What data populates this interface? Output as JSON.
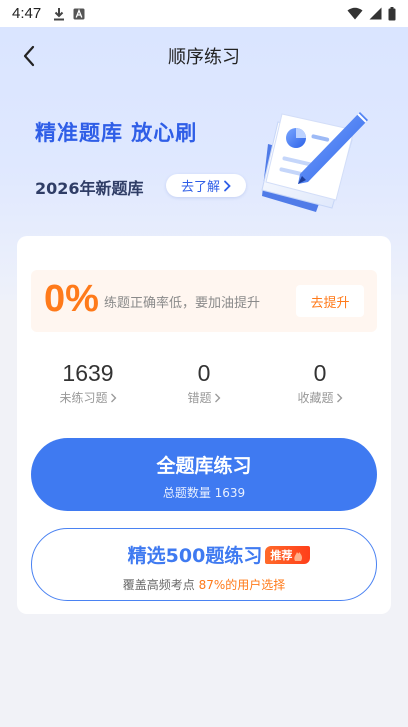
{
  "status_bar": {
    "time": "4:47",
    "icons_left": [
      "download-icon",
      "keyboard-a-icon"
    ],
    "icons_right": [
      "wifi-icon",
      "signal-icon",
      "battery-icon"
    ]
  },
  "nav": {
    "title": "顺序练习",
    "back_icon": "chevron-left-icon"
  },
  "hero": {
    "title": "精准题库 放心刷",
    "subtitle": "2026年新题库",
    "link_label": "去了解",
    "illustration": "document-pen-icon"
  },
  "accuracy": {
    "value": "0%",
    "message": "练题正确率低，要加油提升",
    "button_label": "去提升"
  },
  "stats": [
    {
      "value": "1639",
      "label": "未练习题"
    },
    {
      "value": "0",
      "label": "错题"
    },
    {
      "value": "0",
      "label": "收藏题"
    }
  ],
  "all_practice": {
    "title": "全题库练习",
    "subtitle": "总题数量 1639"
  },
  "selected_practice": {
    "title": "精选500题练习",
    "badge": "推荐",
    "subtitle_prefix": "覆盖高频考点 ",
    "subtitle_highlight": "87%的用户选择"
  },
  "colors": {
    "primary": "#3f7af1",
    "accent": "#ff7a1a",
    "hero_title": "#2f5ee7"
  }
}
